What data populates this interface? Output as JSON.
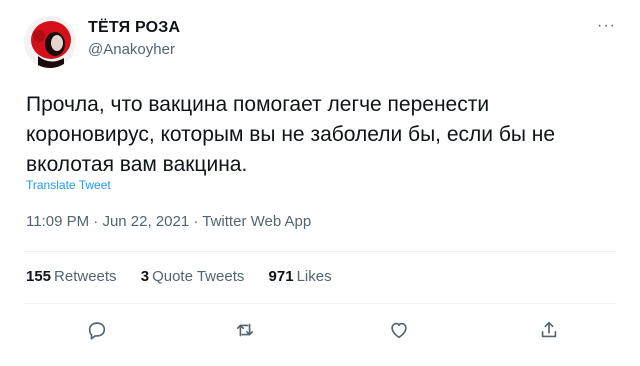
{
  "author": {
    "display_name": "ТЁТЯ РОЗА",
    "handle": "@Anakoyher",
    "avatar_icon": "avatar-red-portrait-icon"
  },
  "tweet": {
    "text": "Прочла, что вакцина помогает легче перенести короновирус, которым вы не заболели бы, если бы не вколотая вам вакцина.",
    "translate_label": "Translate Tweet",
    "time": "11:09 PM",
    "date": "Jun 22, 2021",
    "source": "Twitter Web App",
    "separator": "·"
  },
  "stats": {
    "retweets": {
      "count": "155",
      "label": "Retweets"
    },
    "quotes": {
      "count": "3",
      "label": "Quote Tweets"
    },
    "likes": {
      "count": "971",
      "label": "Likes"
    }
  },
  "actions": [
    "reply-icon",
    "retweet-icon",
    "like-icon",
    "share-icon"
  ],
  "more_icon": "more-options-icon",
  "colors": {
    "text": "#0f1419",
    "secondary": "#536471",
    "link": "#1d9bf0",
    "divider": "#eff3f4",
    "avatar_red": "#d4111b"
  }
}
